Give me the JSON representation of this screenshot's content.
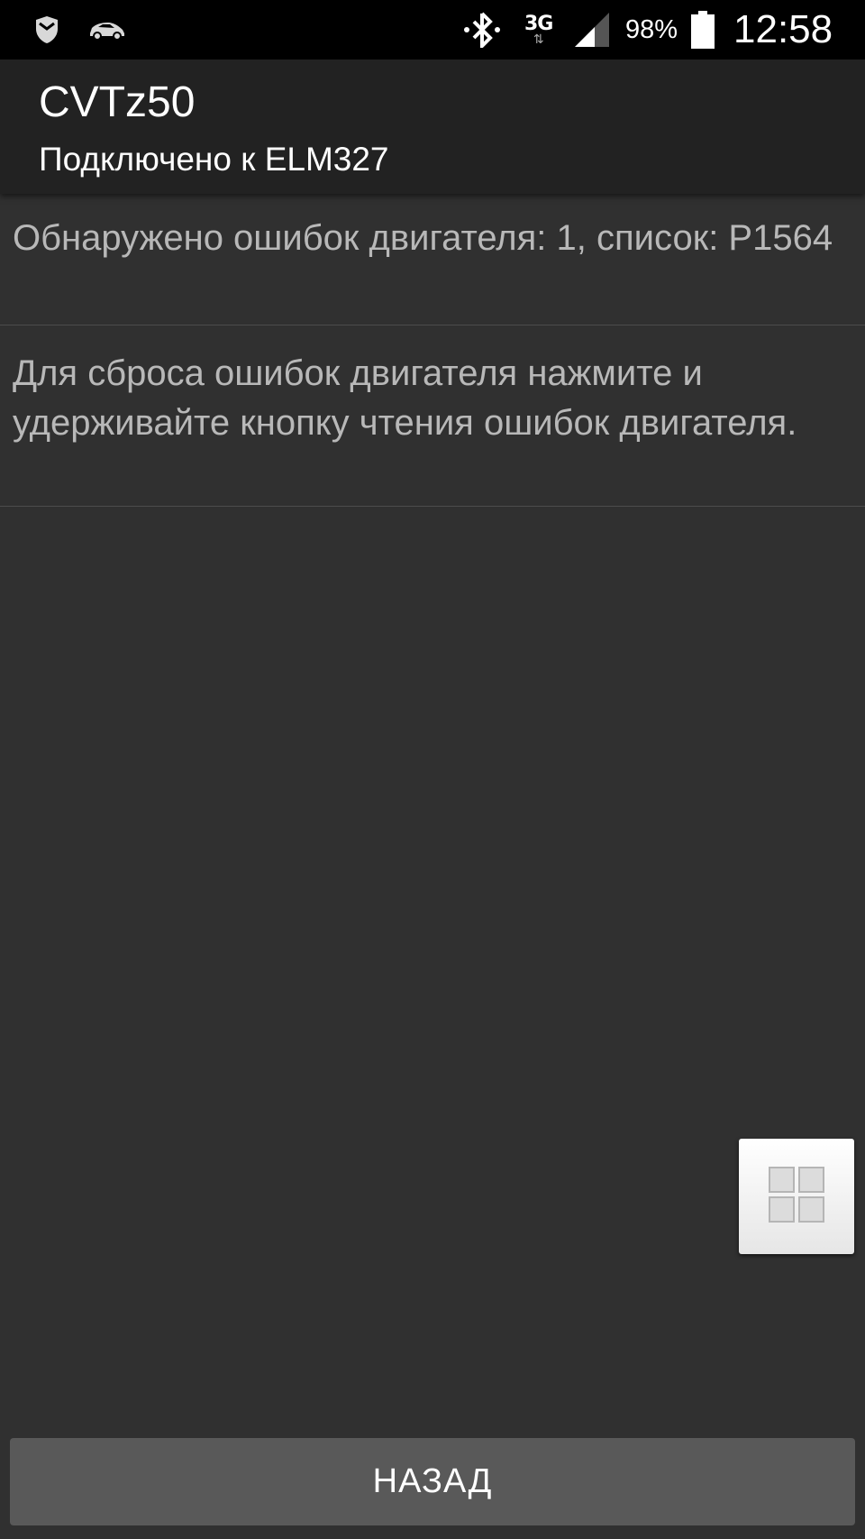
{
  "status_bar": {
    "left_icons": [
      "shield-icon",
      "car-icon"
    ],
    "bluetooth_icon": "bluetooth-icon",
    "network_type": "3G",
    "network_arrows": "⇅",
    "signal_icon": "signal-icon",
    "battery_percent": "98%",
    "battery_icon": "battery-icon",
    "time": "12:58"
  },
  "action_bar": {
    "title": "CVTz50",
    "subtitle": "Подключено к ELM327"
  },
  "messages": [
    {
      "text": "Обнаружено ошибок двигателя: 1, список: P1564"
    },
    {
      "text": "Для сброса ошибок двигателя нажмите и удерживайте кнопку чтения ошибок двигателя."
    }
  ],
  "floating_button": {
    "icon": "grid-icon"
  },
  "back_button": {
    "label": "НАЗАД"
  },
  "colors": {
    "background": "#303030",
    "status_bar": "#000000",
    "action_bar": "#222222",
    "message_text": "#b8b8b8",
    "button": "#595959"
  }
}
